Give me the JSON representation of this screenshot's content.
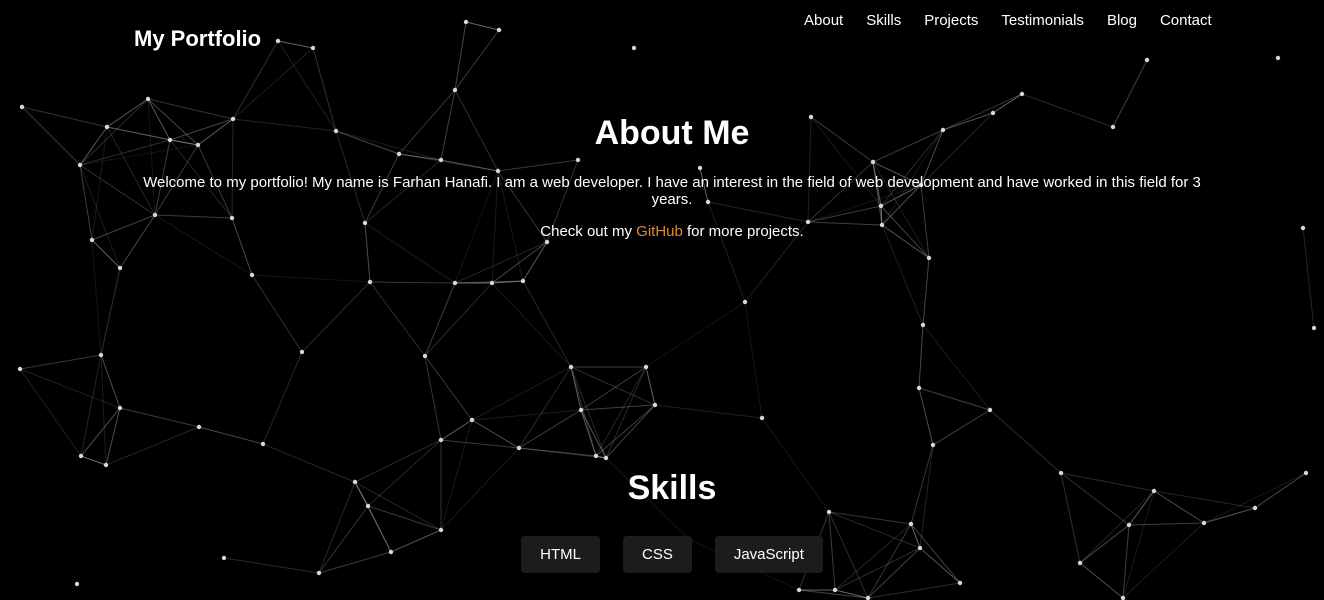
{
  "header": {
    "brand": "My Portfolio",
    "nav": [
      "About",
      "Skills",
      "Projects",
      "Testimonials",
      "Blog",
      "Contact"
    ]
  },
  "about": {
    "title": "About Me",
    "intro": "Welcome to my portfolio! My name is Farhan Hanafi. I am a web developer. I have an interest in the field of web development and have worked in this field for 3 years.",
    "github_prefix": "Check out my ",
    "github_link": "GitHub",
    "github_suffix": " for more projects."
  },
  "skills": {
    "title": "Skills",
    "items": [
      "HTML",
      "CSS",
      "JavaScript"
    ]
  },
  "colors": {
    "background": "#000000",
    "text": "#ffffff",
    "link_accent": "#e08a2e",
    "skill_chip": "#1c1c1c",
    "network_lines": "#9a9a9a"
  }
}
